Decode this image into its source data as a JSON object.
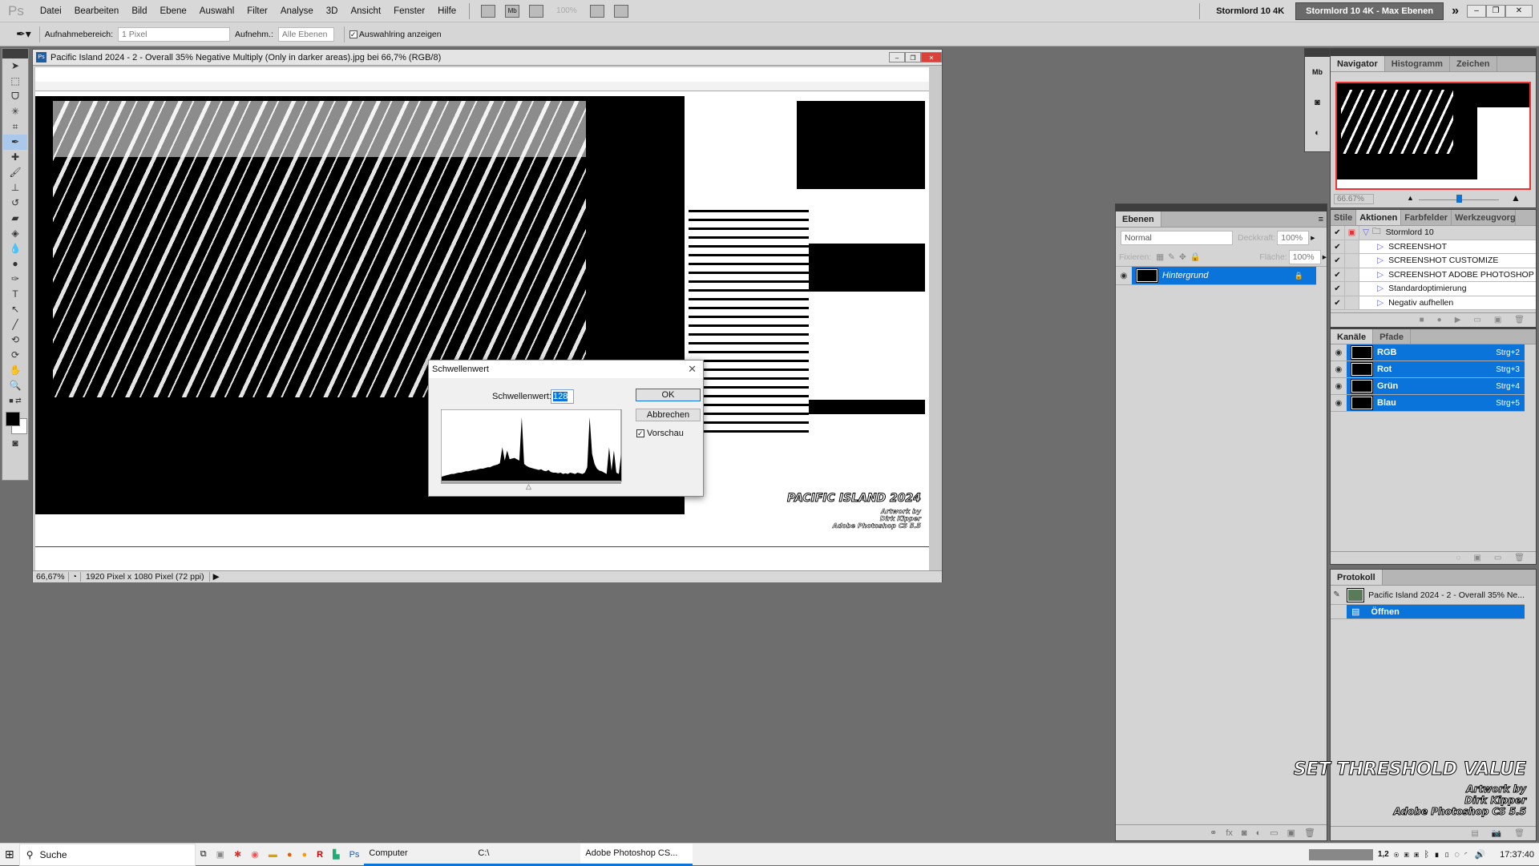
{
  "menubar": {
    "logo": "Ps",
    "items": [
      "Datei",
      "Bearbeiten",
      "Bild",
      "Ebene",
      "Auswahl",
      "Filter",
      "Analyse",
      "3D",
      "Ansicht",
      "Fenster",
      "Hilfe"
    ],
    "zoom": "100%",
    "mb": "Mb",
    "workspaces": [
      "Stormlord 10 4K",
      "Stormlord 10 4K - Max Ebenen"
    ],
    "more": "»"
  },
  "options": {
    "sample_size_label": "Aufnahmebereich:",
    "sample_size_value": "1 Pixel",
    "sample_label": "Aufnehm.:",
    "sample_value": "Alle Ebenen",
    "show_ring_label": "Auswahlring anzeigen",
    "show_ring_checked": true
  },
  "document": {
    "title": "Pacific Island 2024 - 2 - Overall 35% Negative Multiply (Only in darker areas).jpg bei 66,7% (RGB/8)",
    "zoom": "66,67%",
    "info": "1920 Pixel x 1080 Pixel (72 ppi)",
    "canvas_watermark": {
      "title": "PACIFIC ISLAND 2024",
      "line1": "Artwork by",
      "line2": "Dirk Kipper",
      "line3": "Adobe Photoshop CS 5.5"
    }
  },
  "dialog": {
    "title": "Schwellenwert",
    "label": "Schwellenwert:",
    "value": "128",
    "ok": "OK",
    "cancel": "Abbrechen",
    "preview": "Vorschau",
    "preview_checked": true,
    "histogram": [
      6,
      7,
      8,
      9,
      10,
      10,
      11,
      12,
      12,
      13,
      14,
      14,
      15,
      16,
      16,
      17,
      18,
      18,
      19,
      20,
      20,
      22,
      23,
      24,
      26,
      50,
      30,
      45,
      32,
      33,
      34,
      32,
      30,
      95,
      25,
      22,
      20,
      19,
      18,
      17,
      16,
      17,
      15,
      14,
      16,
      13,
      12,
      12,
      11,
      12,
      10,
      11,
      10,
      12,
      11,
      10,
      12,
      11,
      10,
      12,
      20,
      95,
      40,
      25,
      18,
      15,
      14,
      12,
      10,
      50,
      15,
      45,
      12,
      10,
      40
    ]
  },
  "navigator": {
    "tabs": [
      "Navigator",
      "Histogramm",
      "Zeichen"
    ],
    "zoom": "66.67%",
    "slider": 0.5
  },
  "layers": {
    "tab": "Ebenen",
    "blend": "Normal",
    "opacity_label": "Deckkraft:",
    "opacity": "100%",
    "lock_label": "Fixieren:",
    "fill_label": "Fläche:",
    "fill": "100%",
    "items": [
      {
        "name": "Hintergrund",
        "locked": true,
        "selected": true
      }
    ]
  },
  "actions": {
    "tabs": [
      "Stile",
      "Aktionen",
      "Farbfelder",
      "Werkzeugvorgabe"
    ],
    "set": "Stormlord 10",
    "items": [
      "SCREENSHOT",
      "SCREENSHOT CUSTOMIZE",
      "SCREENSHOT ADOBE PHOTOSHOP",
      "Standardoptimierung",
      "Negativ aufhellen"
    ]
  },
  "channels": {
    "tabs": [
      "Kanäle",
      "Pfade"
    ],
    "items": [
      {
        "name": "RGB",
        "shortcut": "Strg+2"
      },
      {
        "name": "Rot",
        "shortcut": "Strg+3"
      },
      {
        "name": "Grün",
        "shortcut": "Strg+4"
      },
      {
        "name": "Blau",
        "shortcut": "Strg+5"
      }
    ]
  },
  "history": {
    "tab": "Protokoll",
    "snapshot": "Pacific Island 2024 - 2 - Overall 35% Ne...",
    "items": [
      "Öffnen"
    ]
  },
  "watermark": {
    "title": "SET THRESHOLD VALUE",
    "line1": "Artwork by",
    "line2": "Dirk Kipper",
    "line3": "Adobe Photoshop CS 5.5"
  },
  "taskbar": {
    "search": "Suche",
    "apps": [
      "Computer",
      "C:\\",
      "Adobe Photoshop CS..."
    ],
    "tray_num": "1,2",
    "clock": "17:37:40"
  },
  "colors": {
    "accent": "#0a74da",
    "workspace": "#6e6e6e"
  }
}
